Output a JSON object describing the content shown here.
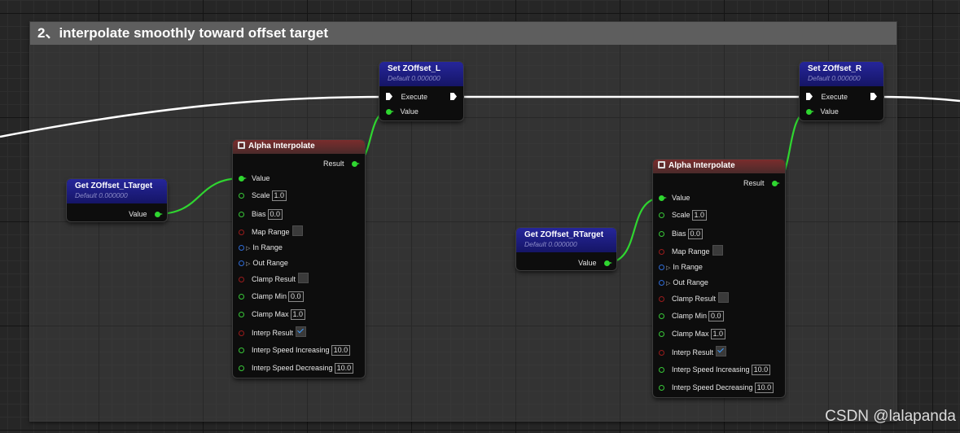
{
  "comment": {
    "title": "2、interpolate smoothly toward offset target"
  },
  "colors": {
    "float_pin": "#2fd630",
    "bool_pin": "#9a1c1c",
    "struct_pin": "#2f6cd6",
    "exec_wire": "#ffffff"
  },
  "nodes": {
    "get_l": {
      "title": "Get ZOffset_LTarget",
      "subtitle": "Default 0.000000",
      "output_label": "Value"
    },
    "get_r": {
      "title": "Get ZOffset_RTarget",
      "subtitle": "Default 0.000000",
      "output_label": "Value"
    },
    "set_l": {
      "title": "Set ZOffset_L",
      "subtitle": "Default 0.000000",
      "execute_label": "Execute",
      "value_label": "Value"
    },
    "set_r": {
      "title": "Set ZOffset_R",
      "subtitle": "Default 0.000000",
      "execute_label": "Execute",
      "value_label": "Value"
    },
    "alpha_l": {
      "title": "Alpha Interpolate",
      "result_label": "Result",
      "value_label": "Value",
      "scale_label": "Scale",
      "scale_value": "1.0",
      "bias_label": "Bias",
      "bias_value": "0.0",
      "map_range_label": "Map Range",
      "in_range_label": "In Range",
      "out_range_label": "Out Range",
      "clamp_result_label": "Clamp Result",
      "clamp_min_label": "Clamp Min",
      "clamp_min_value": "0.0",
      "clamp_max_label": "Clamp Max",
      "clamp_max_value": "1.0",
      "interp_result_label": "Interp Result",
      "interp_inc_label": "Interp Speed Increasing",
      "interp_inc_value": "10.0",
      "interp_dec_label": "Interp Speed Decreasing",
      "interp_dec_value": "10.0"
    },
    "alpha_r": {
      "title": "Alpha Interpolate",
      "result_label": "Result",
      "value_label": "Value",
      "scale_label": "Scale",
      "scale_value": "1.0",
      "bias_label": "Bias",
      "bias_value": "0.0",
      "map_range_label": "Map Range",
      "in_range_label": "In Range",
      "out_range_label": "Out Range",
      "clamp_result_label": "Clamp Result",
      "clamp_min_label": "Clamp Min",
      "clamp_min_value": "0.0",
      "clamp_max_label": "Clamp Max",
      "clamp_max_value": "1.0",
      "interp_result_label": "Interp Result",
      "interp_inc_label": "Interp Speed Increasing",
      "interp_inc_value": "10.0",
      "interp_dec_label": "Interp Speed Decreasing",
      "interp_dec_value": "10.0"
    }
  },
  "watermark": "CSDN @lalapanda"
}
